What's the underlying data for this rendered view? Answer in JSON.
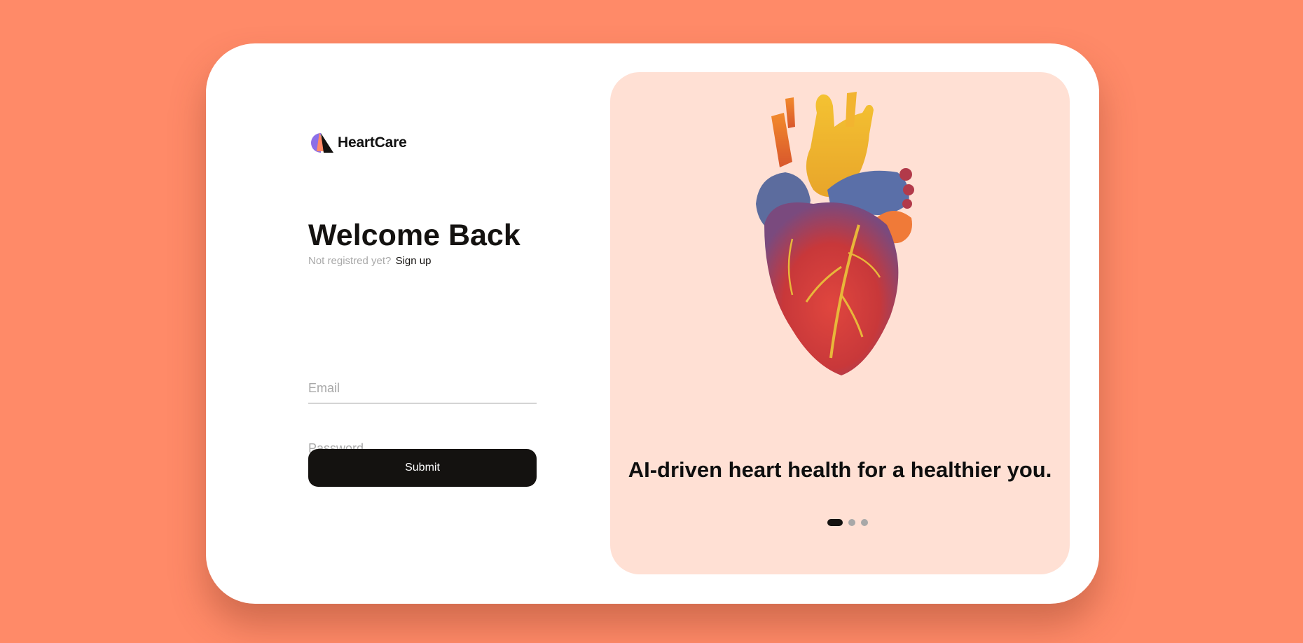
{
  "brand": {
    "name": "HeartCare",
    "logo_icon": "heartcare-logo-icon"
  },
  "login": {
    "title": "Welcome Back",
    "signup_prompt": "Not registred yet?",
    "signup_link": "Sign up",
    "email_placeholder": "Email",
    "email_value": "",
    "password_placeholder": "Password",
    "password_value": "",
    "submit_label": "Submit"
  },
  "promo": {
    "illustration_icon": "anatomical-heart-illustration",
    "tagline": "AI-driven heart health for a healthier you.",
    "carousel": {
      "total": 3,
      "active_index": 0
    }
  },
  "colors": {
    "background": "#FF8A68",
    "card": "#FFFFFF",
    "promo_panel": "#FFE0D4",
    "primary_dark": "#141210",
    "muted_text": "#A8A8A8",
    "logo_purple": "#8B6FE8",
    "logo_orange": "#FF8A68"
  }
}
